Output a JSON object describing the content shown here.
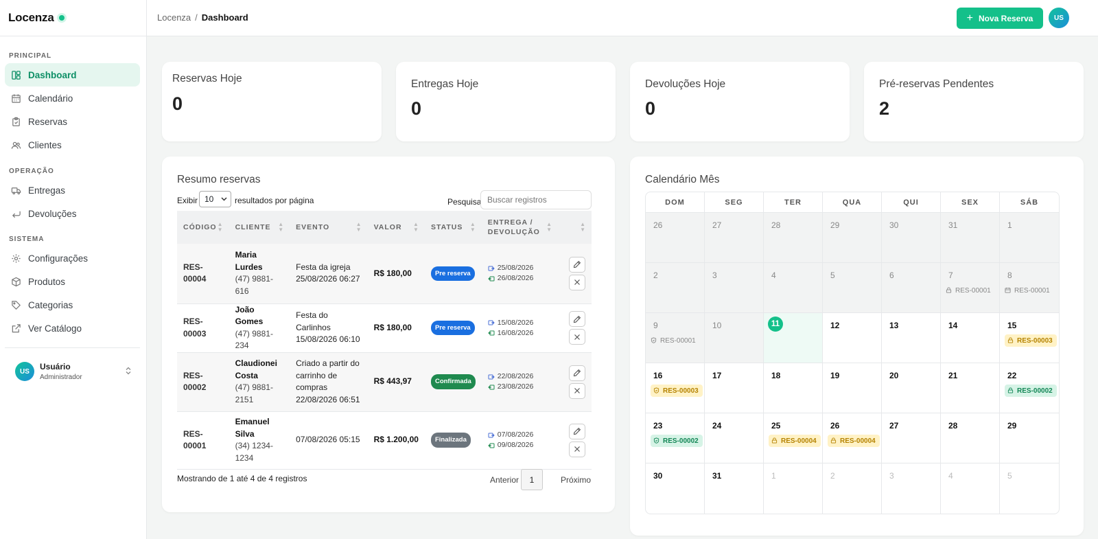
{
  "brand": "Locenza",
  "sidebar": {
    "sections": [
      "PRINCIPAL",
      "OPERAÇÃO",
      "SISTEMA"
    ],
    "items": [
      {
        "label": "Dashboard",
        "icon": "layout-icon",
        "active": true
      },
      {
        "label": "Calendário",
        "icon": "calendar-icon"
      },
      {
        "label": "Reservas",
        "icon": "clipboard-icon"
      },
      {
        "label": "Clientes",
        "icon": "users-icon"
      },
      {
        "label": "Entregas",
        "icon": "truck-icon"
      },
      {
        "label": "Devoluções",
        "icon": "return-icon"
      },
      {
        "label": "Configurações",
        "icon": "gear-icon"
      },
      {
        "label": "Produtos",
        "icon": "box-icon"
      },
      {
        "label": "Categorias",
        "icon": "tag-icon"
      },
      {
        "label": "Ver Catálogo",
        "icon": "external-link-icon"
      }
    ],
    "user": {
      "initials": "US",
      "name": "Usuário",
      "role": "Administrador"
    }
  },
  "topbar": {
    "crumb_root": "Locenza",
    "crumb_sep": "/",
    "crumb_current": "Dashboard",
    "new_button": "Nova Reserva",
    "avatar_initials": "US"
  },
  "stats": [
    {
      "title": "Reservas Hoje",
      "value": "0"
    },
    {
      "title": "Entregas Hoje",
      "value": "0"
    },
    {
      "title": "Devoluções Hoje",
      "value": "0"
    },
    {
      "title": "Pré-reservas Pendentes",
      "value": "2"
    }
  ],
  "summary": {
    "title": "Resumo reservas",
    "show_label": "Exibir",
    "per_page": "10",
    "per_page_suffix": "resultados por página",
    "search_label": "Pesquisar",
    "search_placeholder": "Buscar registros",
    "columns": [
      "CÓDIGO",
      "CLIENTE",
      "EVENTO",
      "VALOR",
      "STATUS",
      "ENTREGA / DEVOLUÇÃO"
    ],
    "rows": [
      {
        "code": "RES-00004",
        "client": "Maria Lurdes",
        "phone": "(47) 9881-616",
        "event": "Festa da igreja",
        "event_date": "25/08/2026 06:27",
        "value": "R$ 180,00",
        "status": "Pre reserva",
        "status_kind": "pre",
        "delivery": "25/08/2026",
        "return": "26/08/2026"
      },
      {
        "code": "RES-00003",
        "client": "João Gomes",
        "phone": "(47) 9881-234",
        "event": "Festa do Carlinhos",
        "event_date": "15/08/2026 06:10",
        "value": "R$ 180,00",
        "status": "Pre reserva",
        "status_kind": "pre",
        "delivery": "15/08/2026",
        "return": "16/08/2026"
      },
      {
        "code": "RES-00002",
        "client": "Claudionei Costa",
        "phone": "(47) 9881-2151",
        "event": "Criado a partir do carrinho de compras",
        "event_date": "22/08/2026 06:51",
        "value": "R$ 443,97",
        "status": "Confirmada",
        "status_kind": "conf",
        "delivery": "22/08/2026",
        "return": "23/08/2026"
      },
      {
        "code": "RES-00001",
        "client": "Emanuel Silva",
        "phone": "(34) 1234-1234",
        "event": "",
        "event_date": "07/08/2026 05:15",
        "value": "R$ 1.200,00",
        "status": "Finalizada",
        "status_kind": "fin",
        "delivery": "07/08/2026",
        "return": "09/08/2026"
      }
    ],
    "footer_info": "Mostrando de 1 até 4 de 4 registros",
    "prev": "Anterior",
    "page": "1",
    "next": "Próximo"
  },
  "calendar": {
    "title": "Calendário Mês",
    "weekdays": [
      "DOM",
      "SEG",
      "TER",
      "QUA",
      "QUI",
      "SEX",
      "SÁB"
    ],
    "weeks": [
      [
        {
          "d": "26",
          "s": "past"
        },
        {
          "d": "27",
          "s": "past"
        },
        {
          "d": "28",
          "s": "past"
        },
        {
          "d": "29",
          "s": "past"
        },
        {
          "d": "30",
          "s": "past"
        },
        {
          "d": "31",
          "s": "past"
        },
        {
          "d": "1",
          "s": "past"
        }
      ],
      [
        {
          "d": "2",
          "s": "past"
        },
        {
          "d": "3",
          "s": "past"
        },
        {
          "d": "4",
          "s": "past"
        },
        {
          "d": "5",
          "s": "past"
        },
        {
          "d": "6",
          "s": "past"
        },
        {
          "d": "7",
          "s": "past",
          "ev": "RES-00001",
          "evk": "gray",
          "evi": "lock-icon"
        },
        {
          "d": "8",
          "s": "past",
          "ev": "RES-00001",
          "evk": "gray",
          "evi": "calendar-icon"
        }
      ],
      [
        {
          "d": "9",
          "s": "past",
          "ev": "RES-00001",
          "evk": "gray",
          "evi": "shield-icon"
        },
        {
          "d": "10",
          "s": "past"
        },
        {
          "d": "11",
          "s": "today"
        },
        {
          "d": "12"
        },
        {
          "d": "13"
        },
        {
          "d": "14"
        },
        {
          "d": "15",
          "ev": "RES-00003",
          "evk": "yellow",
          "evi": "lock-icon"
        }
      ],
      [
        {
          "d": "16",
          "ev": "RES-00003",
          "evk": "yellow",
          "evi": "shield-icon"
        },
        {
          "d": "17"
        },
        {
          "d": "18"
        },
        {
          "d": "19"
        },
        {
          "d": "20"
        },
        {
          "d": "21"
        },
        {
          "d": "22",
          "ev": "RES-00002",
          "evk": "green",
          "evi": "lock-icon"
        }
      ],
      [
        {
          "d": "23",
          "ev": "RES-00002",
          "evk": "green",
          "evi": "shield-icon"
        },
        {
          "d": "24"
        },
        {
          "d": "25",
          "ev": "RES-00004",
          "evk": "yellow",
          "evi": "lock-icon"
        },
        {
          "d": "26",
          "ev": "RES-00004",
          "evk": "yellow",
          "evi": "lock-icon"
        },
        {
          "d": "27"
        },
        {
          "d": "28"
        },
        {
          "d": "29"
        }
      ],
      [
        {
          "d": "30"
        },
        {
          "d": "31"
        },
        {
          "d": "1",
          "s": "other"
        },
        {
          "d": "2",
          "s": "other"
        },
        {
          "d": "3",
          "s": "other"
        },
        {
          "d": "4",
          "s": "other"
        },
        {
          "d": "5",
          "s": "other"
        }
      ]
    ]
  },
  "colors": {
    "accent": "#14c08a",
    "pre": "#1a6fe0",
    "confirmed": "#1f8a4f",
    "finished": "#6c757d"
  }
}
